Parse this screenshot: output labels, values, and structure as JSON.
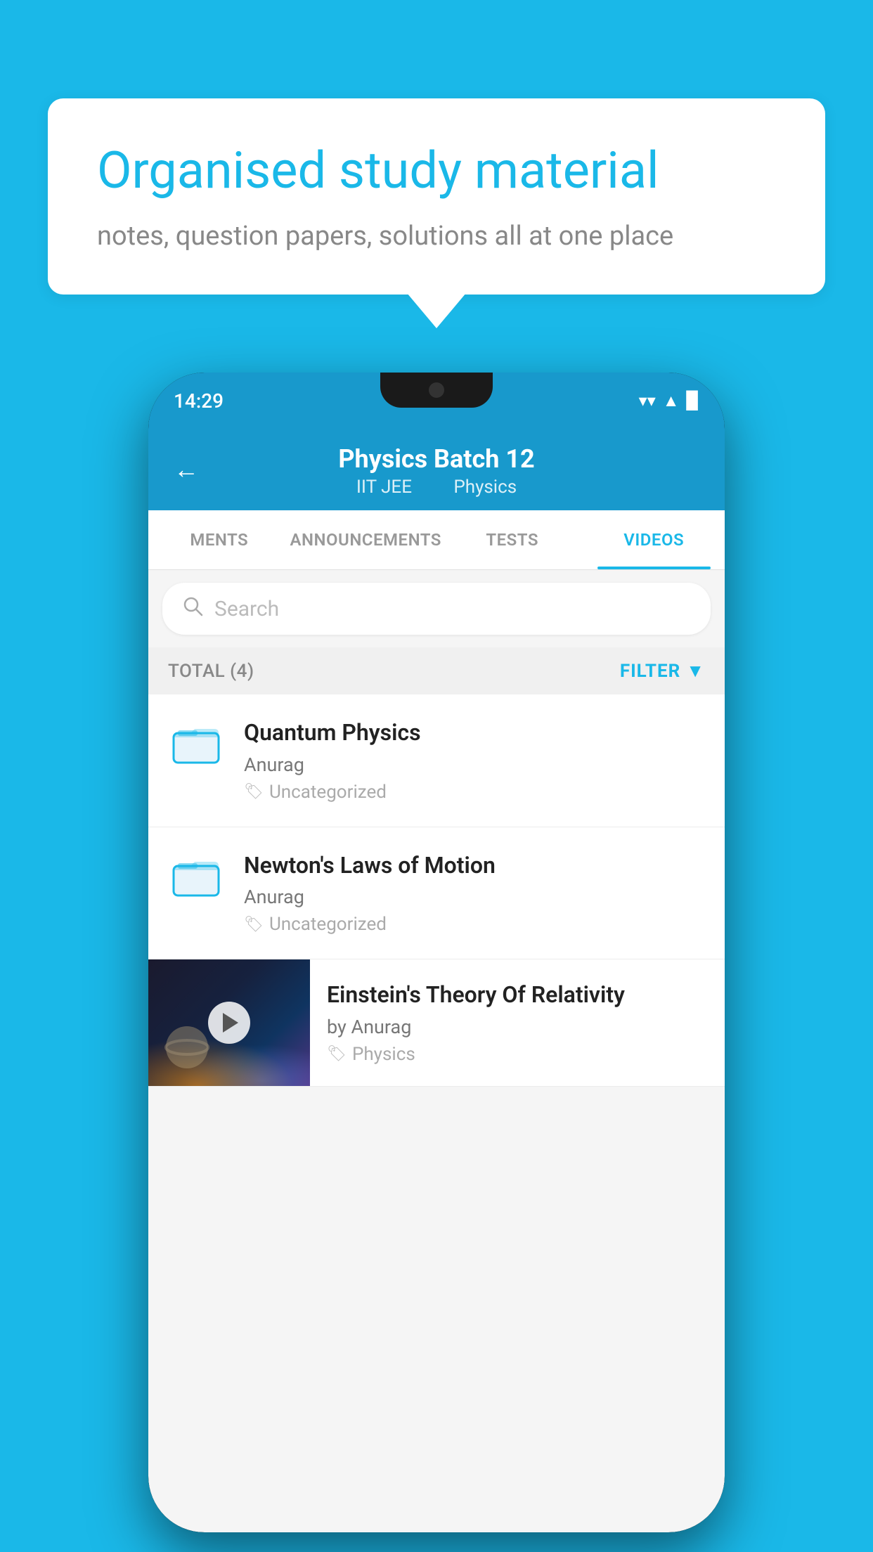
{
  "background_color": "#1ab8e8",
  "speech_bubble": {
    "heading": "Organised study material",
    "subtext": "notes, question papers, solutions all at one place"
  },
  "phone": {
    "status_bar": {
      "time": "14:29"
    },
    "header": {
      "back_label": "←",
      "title": "Physics Batch 12",
      "subtitle_part1": "IIT JEE",
      "subtitle_part2": "Physics"
    },
    "tabs": [
      {
        "label": "MENTS",
        "active": false
      },
      {
        "label": "ANNOUNCEMENTS",
        "active": false
      },
      {
        "label": "TESTS",
        "active": false
      },
      {
        "label": "VIDEOS",
        "active": true
      }
    ],
    "search": {
      "placeholder": "Search"
    },
    "filter": {
      "total_label": "TOTAL (4)",
      "filter_label": "FILTER"
    },
    "videos": [
      {
        "id": "quantum-physics",
        "title": "Quantum Physics",
        "author": "Anurag",
        "tag": "Uncategorized",
        "has_thumbnail": false
      },
      {
        "id": "newtons-laws",
        "title": "Newton's Laws of Motion",
        "author": "Anurag",
        "tag": "Uncategorized",
        "has_thumbnail": false
      },
      {
        "id": "einsteins-theory",
        "title": "Einstein's Theory Of Relativity",
        "author": "by Anurag",
        "tag": "Physics",
        "has_thumbnail": true
      }
    ]
  }
}
